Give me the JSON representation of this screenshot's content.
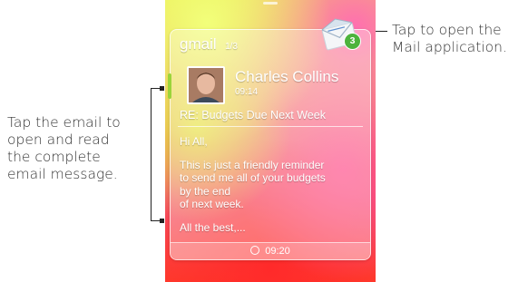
{
  "annotations": {
    "left_lines": [
      "Tap the email to",
      "open and read",
      "the complete",
      "email message."
    ],
    "right_lines": [
      "Tap to open the",
      "Mail application."
    ]
  },
  "widget": {
    "account": "gmail",
    "page": "1/3",
    "unread_count": "3",
    "sender": "Charles Collins",
    "received_time": "09:14",
    "subject": "RE: Budgets Due Next Week",
    "body_lines": [
      "Hi All,",
      "",
      "This is just a friendly reminder",
      "to send me all of your budgets",
      "by the end",
      "of next week.",
      "",
      "All the best,..."
    ],
    "sync_time": "09:20"
  },
  "icons": [
    "mail-envelope-icon",
    "sync-icon"
  ],
  "colors": {
    "accent_green": "#9bd43a",
    "badge_green": "#4db33d"
  }
}
